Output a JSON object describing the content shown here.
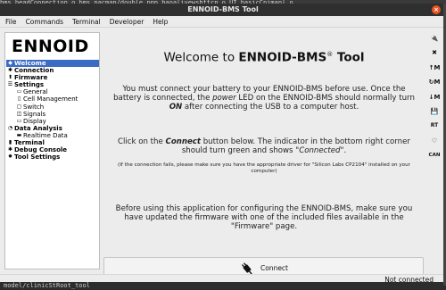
{
  "background": {
    "top_text": "bms_beadConnection.o     bms_pacmap/double.ppp     baoalivewshttcp.o       UI_basicCnimanl.o",
    "bottom_text": "model/clinicStRoot_tool"
  },
  "window": {
    "title": "ENNOID-BMS Tool",
    "close_glyph": "×"
  },
  "menu": [
    {
      "label": "File"
    },
    {
      "label": "Commands"
    },
    {
      "label": "Terminal"
    },
    {
      "label": "Developer"
    },
    {
      "label": "Help"
    }
  ],
  "sidebar": {
    "logo": "ENNOID",
    "items": [
      {
        "label": "Welcome",
        "bold": true,
        "active": true,
        "level": 0,
        "icon": "welcome-icon"
      },
      {
        "label": "Connection",
        "bold": true,
        "active": false,
        "level": 0,
        "icon": "connection-icon"
      },
      {
        "label": "Firmware",
        "bold": true,
        "active": false,
        "level": 0,
        "icon": "firmware-icon"
      },
      {
        "label": "Settings",
        "bold": true,
        "active": false,
        "level": 0,
        "icon": "settings-icon"
      },
      {
        "label": "General",
        "bold": false,
        "active": false,
        "level": 1,
        "icon": "general-icon"
      },
      {
        "label": "Cell Management",
        "bold": false,
        "active": false,
        "level": 1,
        "icon": "cell-icon"
      },
      {
        "label": "Switch",
        "bold": false,
        "active": false,
        "level": 1,
        "icon": "switch-icon"
      },
      {
        "label": "Signals",
        "bold": false,
        "active": false,
        "level": 1,
        "icon": "signals-icon"
      },
      {
        "label": "Display",
        "bold": false,
        "active": false,
        "level": 1,
        "icon": "display-icon"
      },
      {
        "label": "Data Analysis",
        "bold": true,
        "active": false,
        "level": 0,
        "icon": "data-analysis-icon"
      },
      {
        "label": "Realtime Data",
        "bold": false,
        "active": false,
        "level": 1,
        "icon": "realtime-icon"
      },
      {
        "label": "Terminal",
        "bold": true,
        "active": false,
        "level": 0,
        "icon": "terminal-icon"
      },
      {
        "label": "Debug Console",
        "bold": true,
        "active": false,
        "level": 0,
        "icon": "debug-icon"
      },
      {
        "label": "Tool Settings",
        "bold": true,
        "active": false,
        "level": 0,
        "icon": "tool-settings-icon"
      }
    ]
  },
  "main": {
    "title_prefix": "Welcome to ",
    "title_bold": "ENNOID-BMS",
    "title_reg": "®",
    "title_suffix": " Tool",
    "para1_a": "You must connect your battery to your ENNOID-BMS before use. Once the battery is connected, the ",
    "para1_power": "power",
    "para1_b": " LED on the ENNOID-BMS should normally turn ",
    "para1_on": "ON",
    "para1_c": " after connecting the USB to a computer host.",
    "para2_a": "Click on the ",
    "para2_connect": "Connect",
    "para2_b": " button below. The indicator in the bottom right corner should turn green and shows \"",
    "para2_connected": "Connected",
    "para2_c": "\".",
    "note": "(If the connection fails, please make sure you have the appropriate driver for \"Silicon Labs CP2104\" installed on your computer)",
    "para3": "Before using this application for configuring the ENNOID-BMS, make sure you have updated the firmware with one of the included files available in the \"Firmware\" page."
  },
  "connect_button": {
    "label": "Connect",
    "icon": "plug-icon"
  },
  "toolbar": [
    {
      "name": "connect-tool-icon",
      "glyph": "🔌",
      "interactable": true
    },
    {
      "name": "disconnect-tool-icon",
      "glyph": "✖",
      "interactable": true
    },
    {
      "name": "read-config-icon",
      "glyph": "↑M",
      "interactable": true
    },
    {
      "name": "read-default-config-icon",
      "glyph": "↻M",
      "interactable": true
    },
    {
      "name": "write-config-icon",
      "glyph": "↓M",
      "interactable": true
    },
    {
      "name": "save-config-icon",
      "glyph": "💾",
      "interactable": true
    },
    {
      "name": "realtime-toggle-icon",
      "glyph": "RT",
      "interactable": true
    },
    {
      "name": "heart-icon",
      "glyph": "♡",
      "interactable": true
    },
    {
      "name": "can-icon",
      "glyph": "CAN",
      "interactable": true
    }
  ],
  "status": {
    "text": "Not connected"
  },
  "colors": {
    "active_nav": "#3b6cc4",
    "close_button": "#e95420",
    "titlebar": "#2f2f2f"
  }
}
